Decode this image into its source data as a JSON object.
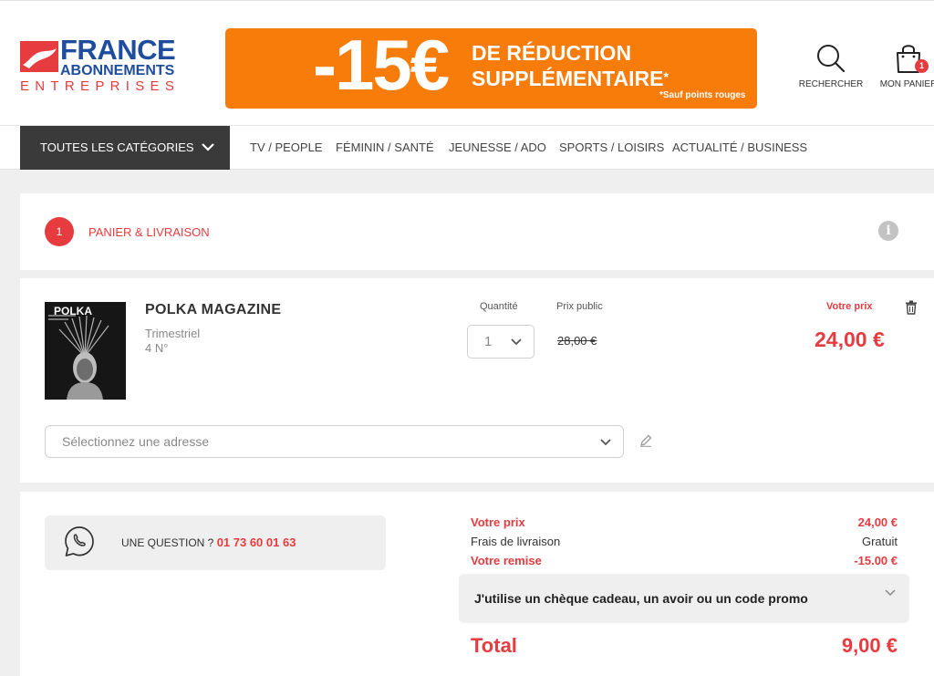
{
  "header": {
    "logo": {
      "line1": "FRANCE",
      "line2": "ABONNEMENTS",
      "line3": "ENTREPRISES"
    },
    "promo": {
      "amount": "-15€",
      "line1": "DE RÉDUCTION",
      "line2": "SUPPLÉMENTAIRE",
      "asterisk": "*",
      "note": "*Sauf points rouges"
    },
    "search_label": "RECHERCHER",
    "cart_label": "MON PANIER",
    "cart_count": "1"
  },
  "nav": {
    "all_categories": "TOUTES LES CATÉGORIES",
    "items": [
      "TV / PEOPLE",
      "FÉMININ / SANTÉ",
      "JEUNESSE / ADO",
      "SPORTS / LOISIRS",
      "ACTUALITÉ / BUSINESS"
    ]
  },
  "step": {
    "number": "1",
    "label": "PANIER & LIVRAISON",
    "info": "i"
  },
  "product": {
    "cover_title": "POLKA",
    "name": "POLKA MAGAZINE",
    "frequency": "Trimestriel",
    "issues": "4 N°",
    "quantity_label": "Quantité",
    "quantity": "1",
    "public_price_label": "Prix public",
    "public_price": "28,00 €",
    "your_price_label": "Votre prix",
    "your_price": "24,00 €",
    "address_placeholder": "Sélectionnez une adresse"
  },
  "summary": {
    "question_label": "UNE QUESTION ? ",
    "phone": "01 73 60 01 63",
    "rows": [
      {
        "label": "Votre prix",
        "value": "24,00 €"
      },
      {
        "label": "Frais de livraison",
        "value": "Gratuit"
      },
      {
        "label": "Votre remise",
        "value": "-15.00 €"
      }
    ],
    "promo_code_label": "J'utilise un chèque cadeau, un avoir ou un code promo",
    "total_label": "Total",
    "total_value": "9,00 €"
  },
  "colors": {
    "accent": "#e63b3f",
    "promo_orange": "#f77c0a",
    "logo_blue": "#1f4d9e",
    "nav_dark": "#3a3a3a"
  }
}
